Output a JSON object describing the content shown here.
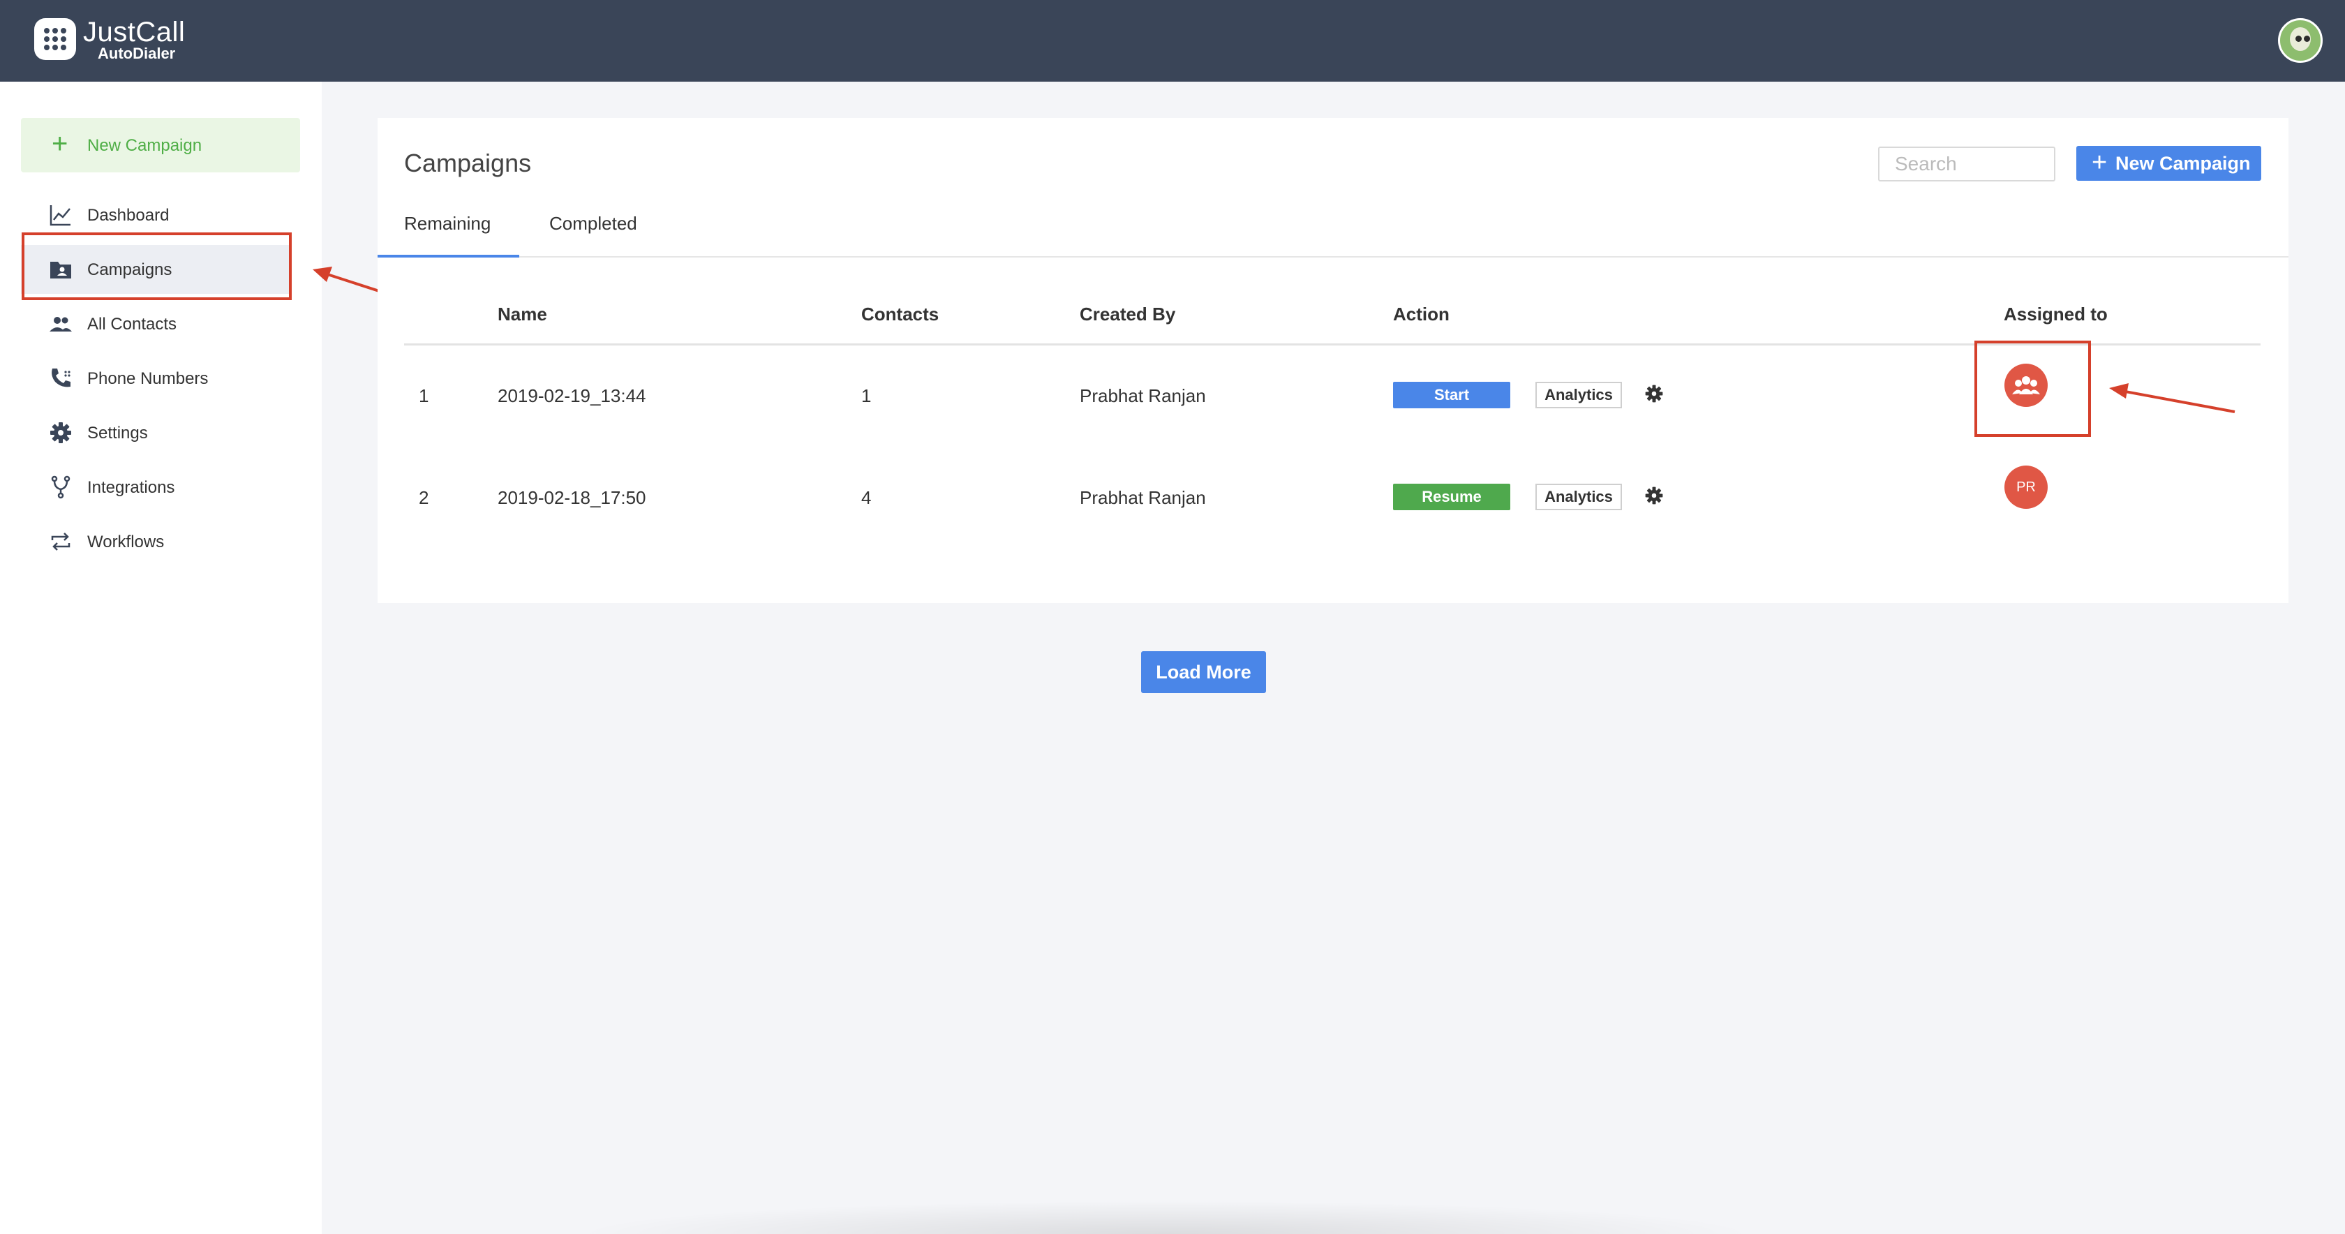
{
  "app": {
    "name": "JustCall",
    "subtitle": "AutoDialer"
  },
  "sidebar": {
    "new_campaign_label": "New Campaign",
    "items": [
      {
        "label": "Dashboard",
        "icon": "chart-line-icon"
      },
      {
        "label": "Campaigns",
        "icon": "folder-contact-icon",
        "active": true
      },
      {
        "label": "All Contacts",
        "icon": "people-icon"
      },
      {
        "label": "Phone Numbers",
        "icon": "phone-icon"
      },
      {
        "label": "Settings",
        "icon": "gear-icon"
      },
      {
        "label": "Integrations",
        "icon": "fork-icon"
      },
      {
        "label": "Workflows",
        "icon": "repeat-icon"
      }
    ]
  },
  "main": {
    "title": "Campaigns",
    "search_placeholder": "Search",
    "new_campaign_label": "New Campaign",
    "tabs": [
      {
        "label": "Remaining",
        "active": true
      },
      {
        "label": "Completed",
        "active": false
      }
    ],
    "table": {
      "columns": [
        "Name",
        "Contacts",
        "Created By",
        "Action",
        "Assigned to"
      ],
      "rows": [
        {
          "index": "1",
          "name": "2019-02-19_13:44",
          "contacts": "1",
          "created_by": "Prabhat Ranjan",
          "action": "Start",
          "action_color": "#4a86e8",
          "analytics": "Analytics",
          "assigned": "group-icon"
        },
        {
          "index": "2",
          "name": "2019-02-18_17:50",
          "contacts": "4",
          "created_by": "Prabhat Ranjan",
          "action": "Resume",
          "action_color": "#4fa94d",
          "analytics": "Analytics",
          "assigned_initials": "PR"
        }
      ]
    },
    "load_more_label": "Load More"
  },
  "colors": {
    "topbar": "#3a4558",
    "accent": "#4a86e8",
    "success": "#4fa94d",
    "annotation": "#d5402b",
    "assignee": "#e05745"
  }
}
